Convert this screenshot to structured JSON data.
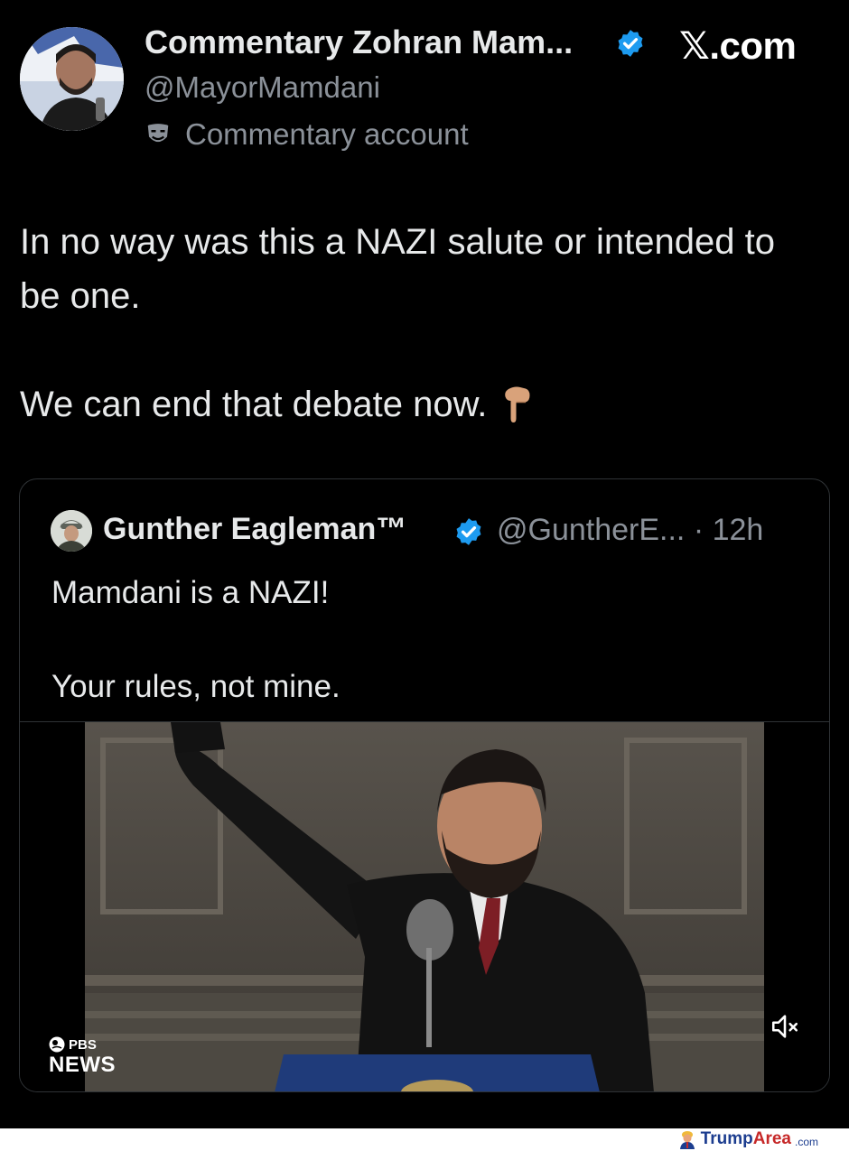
{
  "header": {
    "display_name": "Commentary Zohran Mam...",
    "handle": "@MayorMamdani",
    "account_label": "Commentary account",
    "site_label": "𝕏.com"
  },
  "tweet": {
    "line1": "In no way was this a NAZI salute or intended to be one.",
    "line2": "We can end that debate now."
  },
  "quote": {
    "name": "Gunther Eagleman™",
    "handle_time": "@GuntherE... · 12h",
    "line1": "Mamdani is a NAZI!",
    "line2": "Your rules, not mine.",
    "video": {
      "watermark_top": "PBS",
      "watermark_bottom": "NEWS"
    }
  },
  "footer": {
    "logo_part1": "Trump",
    "logo_part2": "Area",
    "logo_part3": ".com"
  },
  "colors": {
    "background": "#000000",
    "text": "#e7e9ea",
    "secondary_text": "#8b9199",
    "verified": "#1d9bf0",
    "card_border": "#2f3336"
  },
  "icons": [
    "verified-badge-icon",
    "commentary-mask-icon",
    "pointing-down-emoji",
    "speaker-muted-icon",
    "pbs-logo-icon"
  ]
}
